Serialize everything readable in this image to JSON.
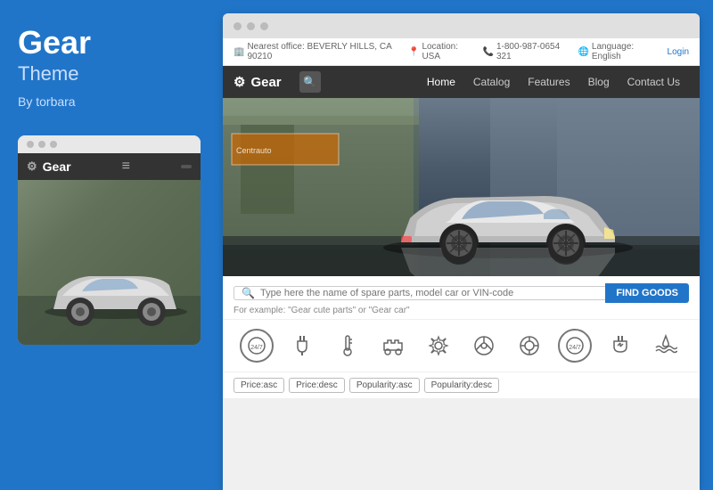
{
  "left": {
    "title": "Gear",
    "subtitle": "Theme",
    "author": "By torbara"
  },
  "mobile_preview": {
    "brand": "Gear",
    "menu_icon": "≡",
    "btn_label": ""
  },
  "browser": {
    "dots": [
      "",
      "",
      ""
    ]
  },
  "topbar": {
    "office": "Nearest office: BEVERLY HILLS, CA 90210",
    "location": "Location: USA",
    "phone": "1-800-987-0654 321",
    "language": "Language: English",
    "login": "Login"
  },
  "navbar": {
    "brand": "Gear",
    "links": [
      "Home",
      "Catalog",
      "Features",
      "Blog",
      "Contact Us"
    ],
    "active_link": "Home"
  },
  "search": {
    "placeholder": "Type here the name of spare parts, model car or VIN-code",
    "hint": "For example: \"Gear cute parts\" or \"Gear car\"",
    "button_label": "FIND GOODS"
  },
  "icons": [
    {
      "symbol": "⏰",
      "type": "circle"
    },
    {
      "symbol": "🔌",
      "type": "box"
    },
    {
      "symbol": "🌡",
      "type": "box"
    },
    {
      "symbol": "🚗",
      "type": "box"
    },
    {
      "symbol": "⚙",
      "type": "box"
    },
    {
      "symbol": "🎮",
      "type": "box"
    },
    {
      "symbol": "⭕",
      "type": "box"
    },
    {
      "symbol": "⏰",
      "type": "circle"
    },
    {
      "symbol": "🔋",
      "type": "box"
    },
    {
      "symbol": "🌊",
      "type": "box"
    }
  ],
  "filters": [
    {
      "label": "Price:asc",
      "active": false
    },
    {
      "label": "Price:desc",
      "active": false
    },
    {
      "label": "Popularity:asc",
      "active": false
    },
    {
      "label": "Popularity:desc",
      "active": false
    }
  ]
}
